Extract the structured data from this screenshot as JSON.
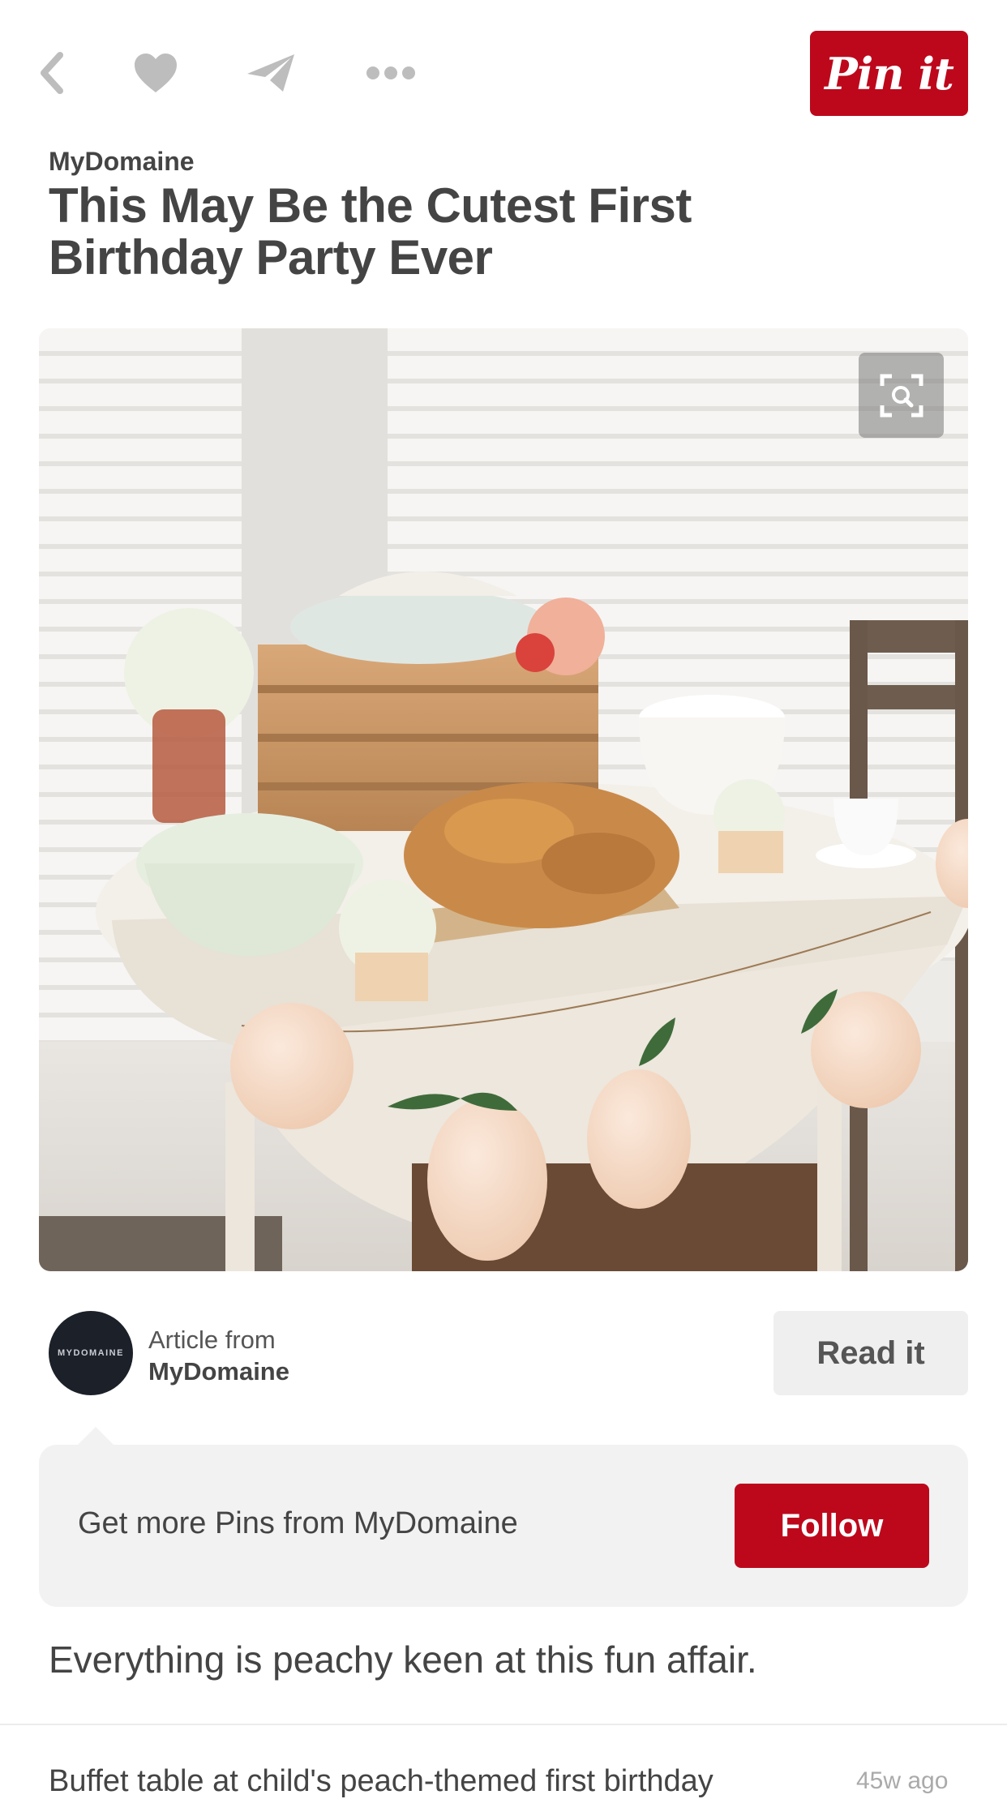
{
  "toolbar": {
    "pin_it_label": "Pin it",
    "icons": [
      "back-icon",
      "heart-icon",
      "send-icon",
      "more-icon"
    ],
    "icon_color": "#bdbdbd",
    "brand_red": "#bd081c"
  },
  "pin": {
    "source": "MyDomaine",
    "title": "This May Be the Cutest First Birthday Party Ever",
    "image_icon": "visual-search-icon"
  },
  "attribution": {
    "avatar_text": "MYDOMAINE",
    "article_from": "Article from",
    "source": "MyDomaine",
    "read_label": "Read it"
  },
  "follow": {
    "text": "Get more Pins from MyDomaine",
    "button_label": "Follow"
  },
  "description": "Everything is peachy keen at this fun affair.",
  "comment": {
    "text": "Buffet table at child's peach-themed first birthday",
    "time": "45w ago"
  }
}
